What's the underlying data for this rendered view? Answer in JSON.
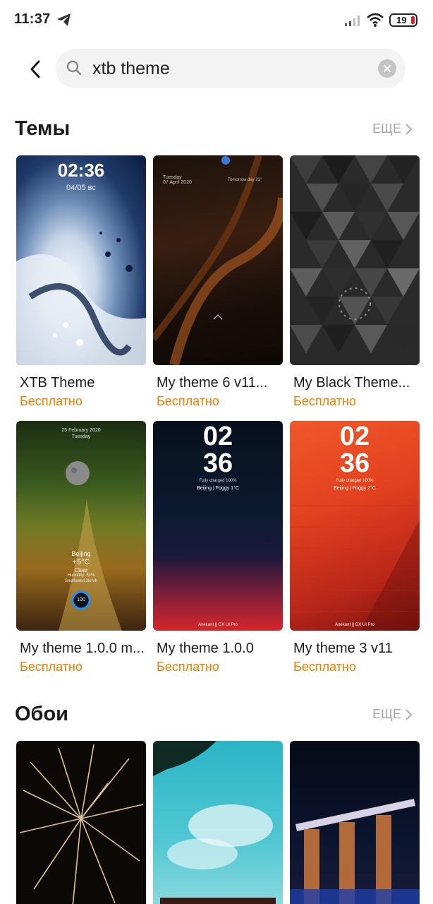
{
  "status": {
    "time": "11:37",
    "battery": "19"
  },
  "search": {
    "query": "xtb theme"
  },
  "themes_section": {
    "title": "Темы",
    "more": "ЕЩЕ",
    "items": [
      {
        "title": "XTB Theme",
        "price": "Бесплатно",
        "preview_time": "02:36",
        "preview_date": "04/05 вс"
      },
      {
        "title": "My theme 6 v11...",
        "price": "Бесплатно",
        "preview_date": "Tuesday\n07 April 2020",
        "preview_weather": "Tomorrow day 21°"
      },
      {
        "title": "My Black Theme...",
        "price": "Бесплатно"
      },
      {
        "title": "My theme 1.0.0 m...",
        "price": "Бесплатно",
        "preview_date": "25 February 2020",
        "preview_day": "Tuesday",
        "preview_city": "Beijing",
        "preview_temp": "+5°C",
        "preview_cond": "Clear",
        "preview_humidity": "Humidity: 51%",
        "preview_wind": "Southwest,2km/h",
        "preview_ring": "100"
      },
      {
        "title": "My theme 1.0.0",
        "price": "Бесплатно",
        "preview_hour": "02",
        "preview_min": "36",
        "preview_charge": "Fully charged 100%",
        "preview_loc": "Beijing | Foggy 1°C",
        "preview_brand": "Anekant || GX UI Pro"
      },
      {
        "title": "My theme 3 v11",
        "price": "Бесплатно",
        "preview_hour": "02",
        "preview_min": "36",
        "preview_charge": "Fully charged 100%",
        "preview_loc": "Beijing | Foggy 2°C",
        "preview_brand": "Anekant || GX UI Pro"
      }
    ]
  },
  "wallpapers_section": {
    "title": "Обои",
    "more": "ЕЩЕ"
  },
  "colors": {
    "accent": "#f07d00",
    "muted": "#a6a6a6"
  }
}
